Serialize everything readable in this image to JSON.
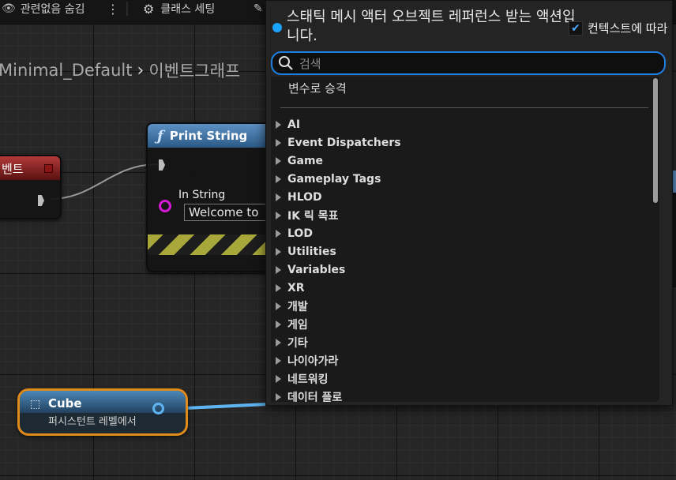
{
  "toolbar": {
    "items": [
      {
        "label": "관련없음 숨김"
      },
      {
        "label": "⋮"
      },
      {
        "label": "클래스 세팅"
      }
    ]
  },
  "breadcrumb": {
    "graph": "Minimal_Default",
    "separator": "›",
    "current": "이벤트그래프"
  },
  "nodes": {
    "event": {
      "label": "벤트"
    },
    "print_string": {
      "title": "Print String",
      "pin_label": "In String",
      "pin_value": "Welcome to"
    },
    "cube": {
      "title": "Cube",
      "subtitle": "퍼시스턴트 레벨에서"
    }
  },
  "action_menu": {
    "title": "스태틱 메시 액터 오브젝트 레퍼런스 받는 액션입니다.",
    "context_label": "컨텍스트에 따라",
    "context_checked": true,
    "search_placeholder": "검색",
    "promote_label": "변수로 승격",
    "categories": [
      "AI",
      "Event Dispatchers",
      "Game",
      "Gameplay Tags",
      "HLOD",
      "IK 릭 목표",
      "LOD",
      "Utilities",
      "Variables",
      "XR",
      "개발",
      "게임",
      "기타",
      "나이아가라",
      "네트워킹",
      "데이터 플로"
    ]
  },
  "colors": {
    "accent": "#1f7fe0",
    "event_header": "#b33a3a",
    "function_header": "#5d91c4",
    "cube_outline": "#e08a1a"
  }
}
